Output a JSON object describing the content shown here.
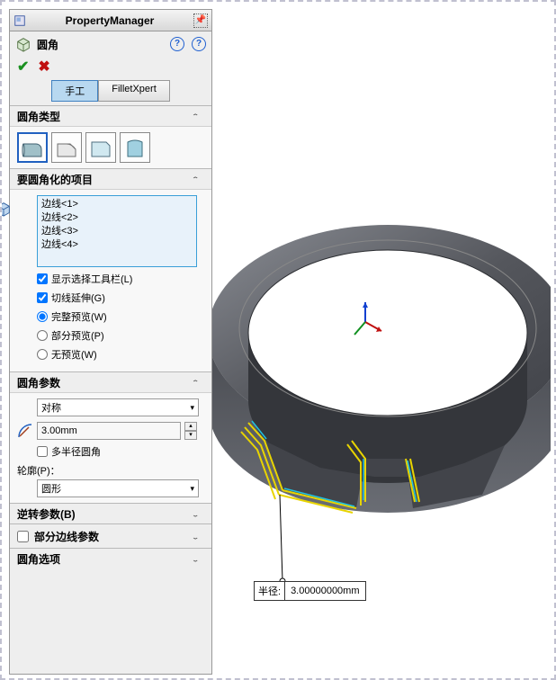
{
  "header": {
    "title": "PropertyManager"
  },
  "feature": {
    "name": "圆角"
  },
  "tabs": [
    "手工",
    "FilletXpert"
  ],
  "sections": {
    "filletType": {
      "title": "圆角类型"
    },
    "items": {
      "title": "要圆角化的项目",
      "list": [
        "边线<1>",
        "边线<2>",
        "边线<3>",
        "边线<4>"
      ],
      "opts": {
        "showToolbar": "显示选择工具栏(L)",
        "tangent": "切线延伸(G)",
        "fullPreview": "完整预览(W)",
        "partialPreview": "部分预览(P)",
        "noPreview": "无预览(W)"
      }
    },
    "params": {
      "title": "圆角参数",
      "symmetry": "对称",
      "radius": "3.00mm",
      "multiRadius": "多半径圆角",
      "profileLabel": "轮廓(P)：",
      "profile": "圆形"
    },
    "setback": {
      "title": "逆转参数(B)"
    },
    "partialEdge": {
      "title": "部分边线参数"
    },
    "filletOptions": {
      "title": "圆角选项"
    }
  },
  "callout": {
    "label": "半径:",
    "value": "3.00000000mm"
  }
}
